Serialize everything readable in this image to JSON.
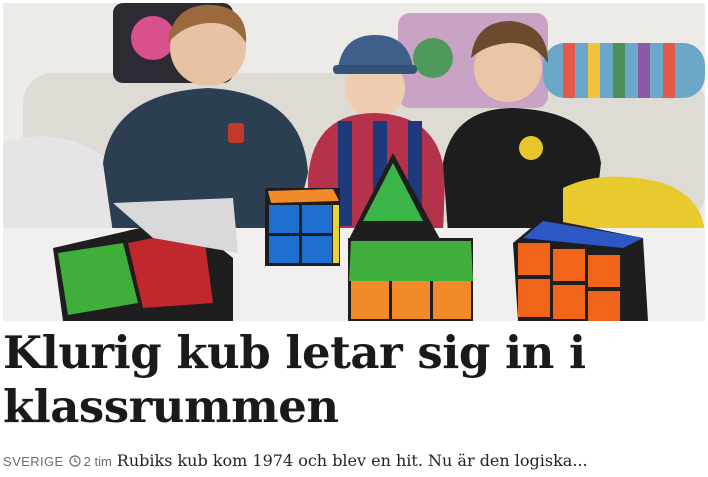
{
  "article": {
    "image_alt": "Tre pojkar i soffa bakom Rubiks kuber",
    "headline": "Klurig kub letar sig in i klassrummen",
    "section": "SVERIGE",
    "time_icon": "clock-icon",
    "time": "2 tim",
    "lead": "Rubiks kub kom 1974 och blev en hit. Nu är den logiska..."
  },
  "colors": {
    "headline": "#1a1a1a",
    "meta": "#6b6b6b",
    "lead": "#222222",
    "background": "#ffffff"
  }
}
